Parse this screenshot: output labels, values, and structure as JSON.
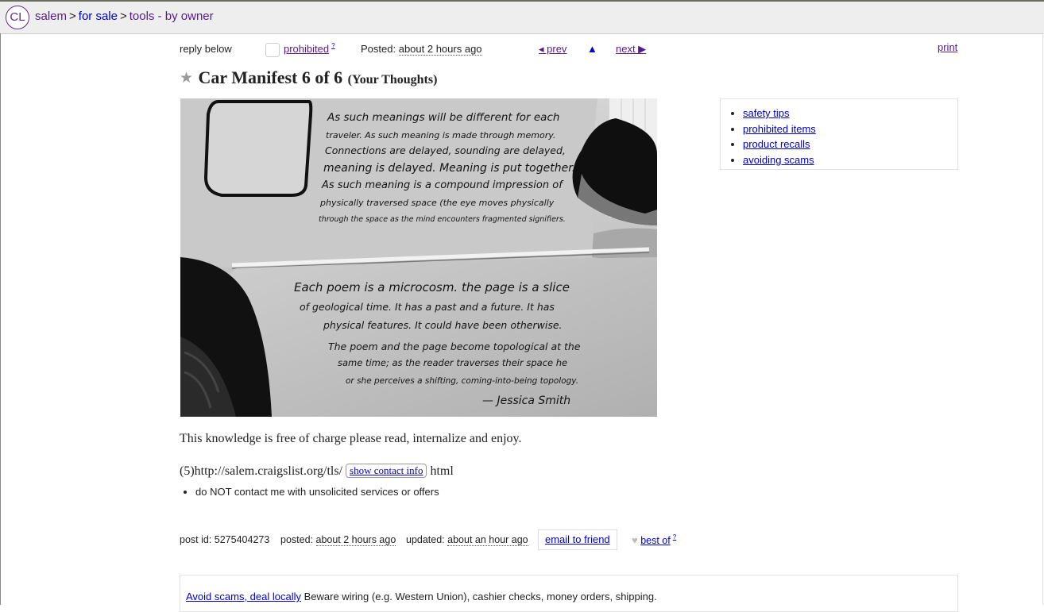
{
  "header": {
    "logo": "CL",
    "breadcrumb": [
      {
        "label": "salem"
      },
      {
        "label": "for sale"
      },
      {
        "label": "tools - by owner"
      }
    ],
    "separator": ">"
  },
  "postnav": {
    "reply": "reply below",
    "flag": "prohibited",
    "help": "?",
    "posted_label": "Posted:",
    "posted_time": "about 2 hours ago",
    "prev": "◂ prev",
    "up": "▲",
    "next": "next ▶",
    "print": "print"
  },
  "post": {
    "title": "Car Manifest 6 of 6",
    "subtitle": "(Your Thoughts)",
    "body": "This knowledge is free of charge please read, internalize and enjoy.",
    "url_prefix": "(5)http://salem.craigslist.org/tls/",
    "show_contact": "show contact info",
    "url_suffix": "html",
    "notices": [
      "do NOT contact me with unsolicited services or offers"
    ]
  },
  "photo_text": {
    "upper": [
      "As such meanings will be different for each",
      "traveler. As such meaning is made through memory.",
      "Connections are delayed, sounding are delayed,",
      "meaning is delayed. Meaning is put together.",
      "As such meaning is a compound impression of",
      "physically traversed space (the eye moves physically",
      "through the space as the mind encounters fragmented signifiers."
    ],
    "lower": [
      "Each poem is a microcosm. the page is a slice",
      "of geological time. It has a past and a future. It has",
      "physical features. It could have been otherwise.",
      "The poem and the page become topological at the",
      "same time; as the reader traverses their space he",
      "or she perceives a shifting, coming-into-being topology."
    ],
    "signature": "— Jessica Smith"
  },
  "safety": {
    "links": [
      "safety tips",
      "prohibited items",
      "product recalls",
      "avoiding scams"
    ]
  },
  "postinfo": {
    "post_id": "post id: 5275404273",
    "posted_label": "posted:",
    "posted_time": "about 2 hours ago",
    "updated_label": "updated:",
    "updated_time": "about an hour ago",
    "email_friend": "email to friend",
    "best_of": "best of",
    "help": "?"
  },
  "scam": {
    "link": "Avoid scams, deal locally",
    "text": " Beware wiring (e.g. Western Union), cashier checks, money orders, shipping."
  }
}
